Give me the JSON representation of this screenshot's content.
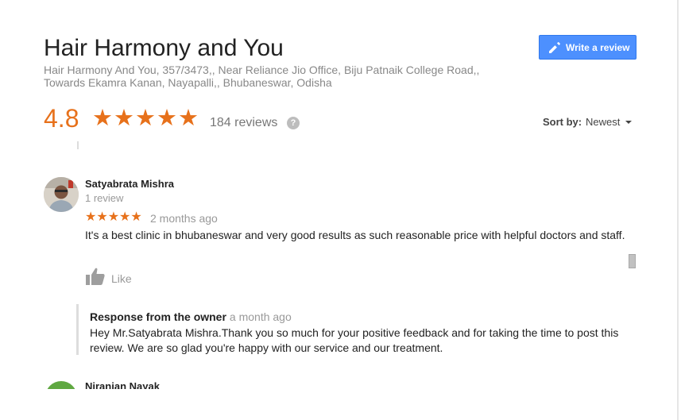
{
  "business": {
    "name": "Hair Harmony and You",
    "address": "Hair Harmony And You, 357/3473,, Near Reliance Jio Office, Biju Patnaik College Road,, Towards Ekamra Kanan, Nayapalli,, Bhubaneswar, Odisha",
    "rating": "4.8",
    "stars": "★★★★★",
    "review_count": "184 reviews",
    "help_glyph": "?"
  },
  "actions": {
    "write_review_label": "Write a review"
  },
  "sort": {
    "label": "Sort by:",
    "value": "Newest"
  },
  "review": {
    "reviewer": "Satyabrata Mishra",
    "reviewer_review_count": "1 review",
    "stars": "★★★★★",
    "rating_value": 5,
    "date": "2 months ago",
    "text": "It's a best clinic in bhubaneswar and very good results as such reasonable price with helpful doctors and staff.",
    "like_label": "Like",
    "owner_response": {
      "title": "Response from the owner",
      "date": "a month ago",
      "text": "Hey Mr.Satyabrata Mishra.Thank you so much for your positive feedback and for taking the time to post this review. We are so glad you're happy with our service and our treatment."
    }
  },
  "next_review": {
    "reviewer": "Niranjan Nayak"
  },
  "colors": {
    "accent_orange": "#e7711b",
    "button_blue": "#4d90fe",
    "muted_text": "#999999"
  },
  "icons": [
    "pencil-icon",
    "star-icon",
    "help-icon",
    "caret-down-icon",
    "thumbs-up-icon",
    "avatar"
  ]
}
